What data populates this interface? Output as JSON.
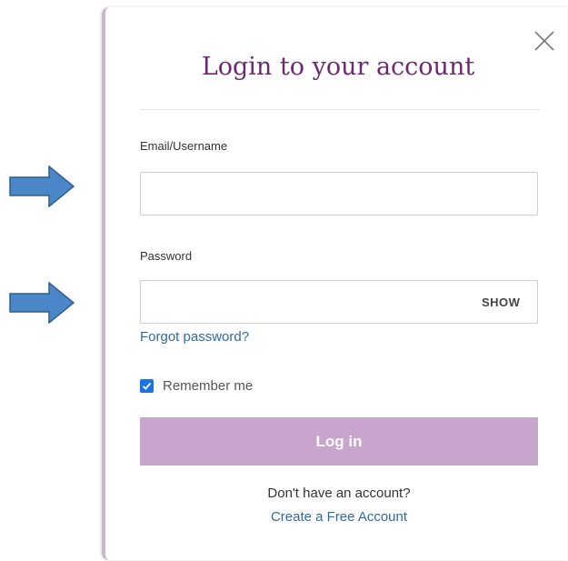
{
  "modal": {
    "title": "Login to your account",
    "close_icon": "close-icon"
  },
  "form": {
    "email_label": "Email/Username",
    "email_value": "",
    "password_label": "Password",
    "password_value": "",
    "show_label": "SHOW",
    "forgot_link": "Forgot password?",
    "remember_label": "Remember me",
    "remember_checked": true,
    "login_button": "Log in"
  },
  "footer": {
    "no_account_text": "Don't have an account?",
    "create_link": "Create a Free Account"
  },
  "colors": {
    "title": "#6b2a6d",
    "login_button_bg": "#c8a5cc",
    "link": "#2f6aa4",
    "arrow_fill": "#4a86c8",
    "checkbox": "#1a73e8"
  },
  "annotations": {
    "arrow_icon": "right-arrow-icon"
  }
}
